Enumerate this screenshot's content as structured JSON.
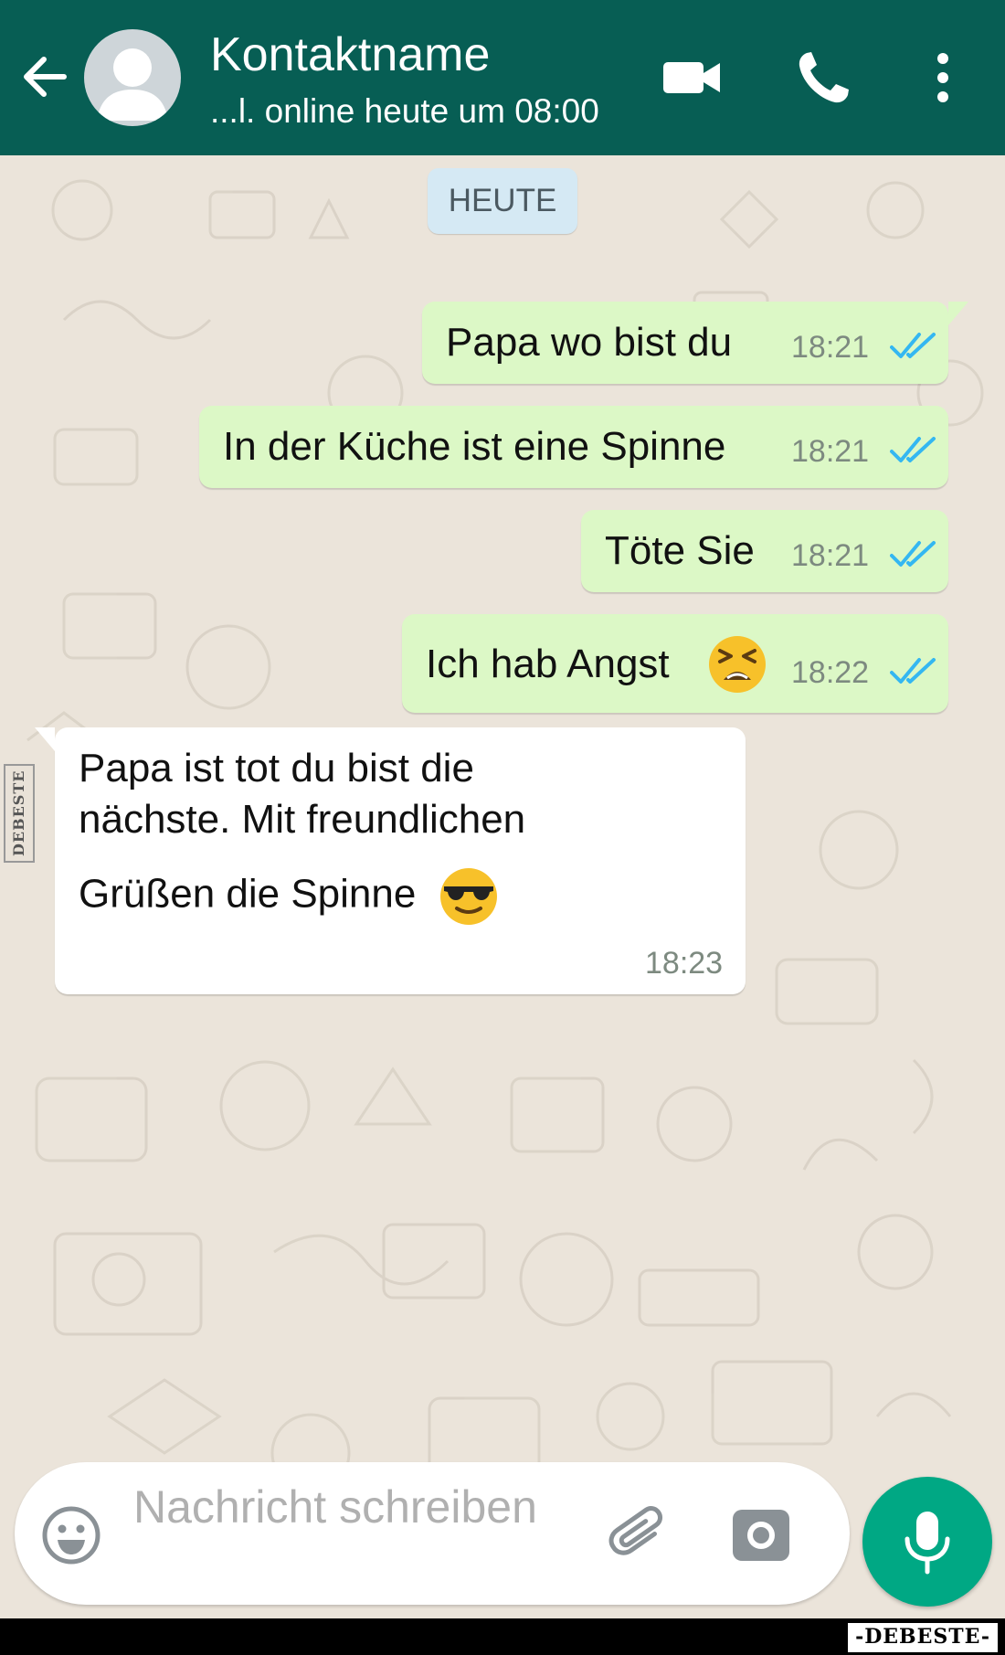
{
  "header": {
    "contact_name": "Kontaktname",
    "status": "...l. online heute um 08:00",
    "icons": [
      "back-arrow-icon",
      "avatar-placeholder-icon",
      "video-call-icon",
      "phone-icon",
      "more-vertical-icon"
    ]
  },
  "chat": {
    "date_label": "HEUTE",
    "messages": [
      {
        "direction": "outgoing",
        "text": "Papa wo bist du",
        "time": "18:21",
        "status": "read"
      },
      {
        "direction": "outgoing",
        "text": "In der Küche ist eine Spinne",
        "time": "18:21",
        "status": "read"
      },
      {
        "direction": "outgoing",
        "text": "Töte Sie",
        "time": "18:21",
        "status": "read"
      },
      {
        "direction": "outgoing",
        "text": "Ich hab Angst",
        "emoji": "tired-face-emoji",
        "time": "18:22",
        "status": "read"
      },
      {
        "direction": "incoming",
        "lines": [
          "Papa ist tot du bist die",
          "nächste. Mit freundlichen",
          "Grüßen die Spinne"
        ],
        "emoji": "sunglasses-face-emoji",
        "time": "18:23"
      }
    ]
  },
  "input": {
    "placeholder": "Nachricht schreiben",
    "icons": [
      "emoji-icon",
      "attach-icon",
      "camera-icon",
      "mic-icon"
    ]
  },
  "watermark": {
    "bottom": "-DEBESTE-",
    "side": "DEBESTE"
  },
  "colors": {
    "header": "#075e54",
    "outgoing_bubble": "#dcf8c6",
    "incoming_bubble": "#ffffff",
    "date_chip": "#d5e9f4",
    "read_ticks": "#34b7f1",
    "mic_button": "#00a884",
    "chat_background": "#ebe4da"
  }
}
